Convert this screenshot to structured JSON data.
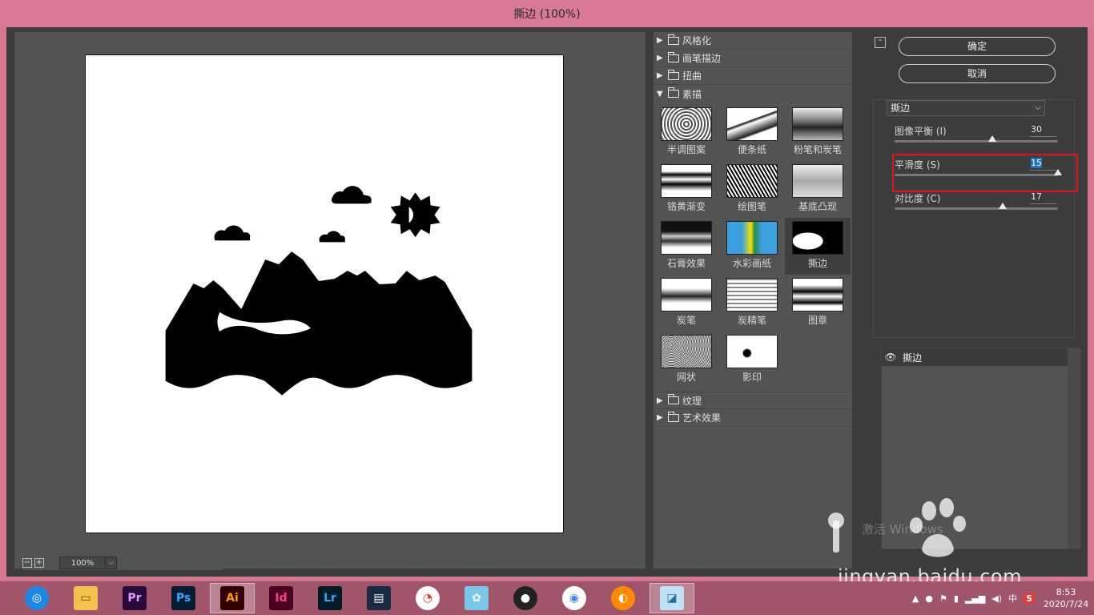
{
  "window": {
    "title": "撕边 (100%)"
  },
  "preview": {
    "zoom_value": "100%"
  },
  "gallery": {
    "categories_top": [
      "风格化",
      "画笔描边",
      "扭曲"
    ],
    "open_category": "素描",
    "filters": [
      {
        "label": "半调图案"
      },
      {
        "label": "便条纸"
      },
      {
        "label": "粉笔和炭笔"
      },
      {
        "label": "铬黄渐变"
      },
      {
        "label": "绘图笔"
      },
      {
        "label": "基底凸现"
      },
      {
        "label": "石膏效果"
      },
      {
        "label": "水彩画纸"
      },
      {
        "label": "撕边"
      },
      {
        "label": "炭笔"
      },
      {
        "label": "炭精笔"
      },
      {
        "label": "图章"
      },
      {
        "label": "网状"
      },
      {
        "label": "影印"
      }
    ],
    "categories_bottom": [
      "纹理",
      "艺术效果"
    ]
  },
  "controls": {
    "ok_label": "确定",
    "cancel_label": "取消",
    "filter_select": "撕边",
    "params": [
      {
        "label": "图像平衡 (I)",
        "value": "30",
        "fraction": 0.6
      },
      {
        "label": "平滑度 (S)",
        "value": "15",
        "fraction": 1.0
      },
      {
        "label": "对比度 (C)",
        "value": "17",
        "fraction": 0.66
      }
    ]
  },
  "layers": {
    "items": [
      {
        "name": "撕边"
      }
    ]
  },
  "watermark": {
    "activate_text": "激活 Windows",
    "site": "jingyan.baidu.com"
  },
  "taskbar": {
    "apps": [
      {
        "name": "browser",
        "label": "",
        "bg": "#1e88e5",
        "fg": "#ffffff"
      },
      {
        "name": "explorer",
        "label": "",
        "bg": "#f2c14e",
        "fg": "#6b4a00"
      },
      {
        "name": "premiere",
        "label": "Pr",
        "bg": "#2a0a3a",
        "fg": "#e89cff"
      },
      {
        "name": "photoshop",
        "label": "Ps",
        "bg": "#061c33",
        "fg": "#31a8ff"
      },
      {
        "name": "illustrator",
        "label": "Ai",
        "bg": "#330000",
        "fg": "#ff9a00"
      },
      {
        "name": "indesign",
        "label": "Id",
        "bg": "#49021f",
        "fg": "#ff3d8b"
      },
      {
        "name": "lightroom",
        "label": "Lr",
        "bg": "#001d26",
        "fg": "#31a8ff"
      },
      {
        "name": "video",
        "label": "",
        "bg": "#1a2a44",
        "fg": "#ffffff"
      },
      {
        "name": "beach-ball",
        "label": "",
        "bg": "#ffffff",
        "fg": "#e53935"
      },
      {
        "name": "pet-app",
        "label": "",
        "bg": "#79c7e8",
        "fg": "#ffffff"
      },
      {
        "name": "qq",
        "label": "",
        "bg": "#222222",
        "fg": "#ffffff"
      },
      {
        "name": "chrome",
        "label": "",
        "bg": "#ffffff",
        "fg": "#4285f4"
      },
      {
        "name": "orange-app",
        "label": "",
        "bg": "#ff8a00",
        "fg": "#ffffff"
      },
      {
        "name": "notes",
        "label": "",
        "bg": "#bfe3f5",
        "fg": "#2a6f97"
      }
    ],
    "active_app": "illustrator",
    "ime": "中",
    "time": "8:53",
    "date": "2020/7/24"
  }
}
